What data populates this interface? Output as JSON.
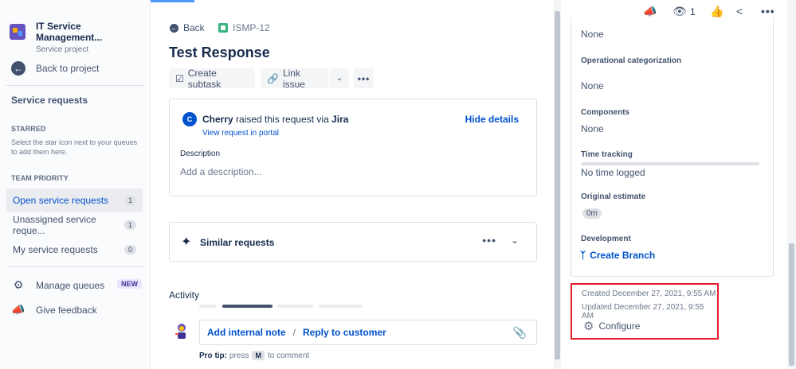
{
  "sidebar": {
    "project_name": "IT Service Management...",
    "project_type": "Service project",
    "back_label": "Back to project",
    "section_title": "Service requests",
    "starred_label": "STARRED",
    "starred_help": "Select the star icon next to your queues to add them here.",
    "team_priority_label": "TEAM PRIORITY",
    "queues": [
      {
        "label": "Open service requests",
        "count": "1"
      },
      {
        "label": "Unassigned service reque...",
        "count": "1"
      },
      {
        "label": "My service requests",
        "count": "0"
      }
    ],
    "manage_queues": "Manage queues",
    "new_badge": "NEW",
    "give_feedback": "Give feedback"
  },
  "issue": {
    "back_label": "Back",
    "key": "ISMP-12",
    "title": "Test Response",
    "toolbar": {
      "create_subtask": "Create subtask",
      "link_issue": "Link issue"
    },
    "request": {
      "avatar_initial": "C",
      "reporter": "Cherry",
      "raised_text": "raised this request via",
      "channel": "Jira",
      "hide_details": "Hide details",
      "view_portal": "View request in portal",
      "description_label": "Description",
      "description_placeholder": "Add a description..."
    },
    "similar_requests": "Similar requests",
    "activity_label": "Activity",
    "comment": {
      "add_internal_note": "Add internal note",
      "separator": "/",
      "reply_to_customer": "Reply to customer"
    },
    "pro_tip": {
      "label": "Pro tip:",
      "press": "press",
      "key": "M",
      "suffix": "to comment"
    }
  },
  "right_panel": {
    "watch_count": "1",
    "fields": [
      {
        "label": "",
        "value": "None"
      },
      {
        "label": "Operational categorization",
        "value": "None"
      },
      {
        "label": "Components",
        "value": "None"
      },
      {
        "label": "Time tracking",
        "value": "No time logged"
      },
      {
        "label": "Original estimate",
        "value": "0m"
      },
      {
        "label": "Development",
        "value": "Create Branch"
      }
    ],
    "created": "Created December 27, 2021, 9:55 AM",
    "updated": "Updated December 27, 2021, 9:55 AM",
    "configure": "Configure"
  },
  "colors": {
    "accent": "#0052CC",
    "highlight": "#E61E2B",
    "project_logo": "#6554C0"
  }
}
